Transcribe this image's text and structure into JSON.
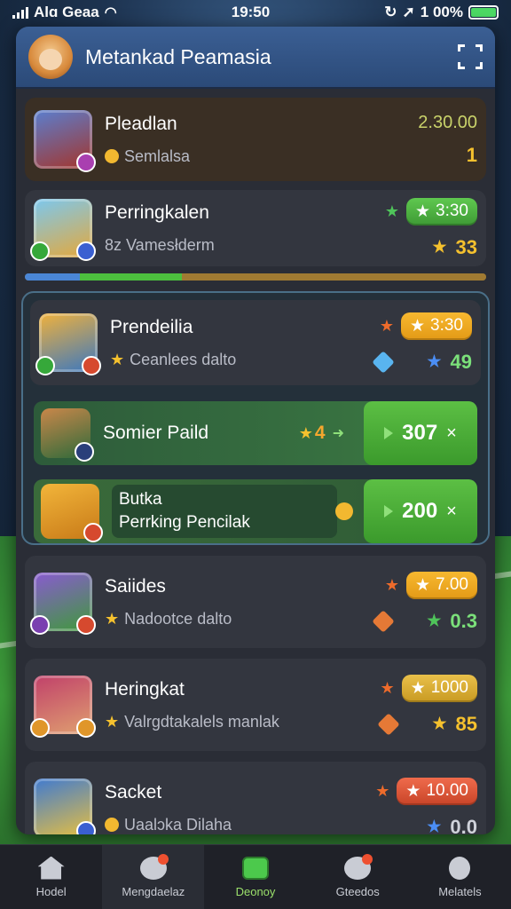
{
  "status": {
    "carrier": "Alɑ Geaa",
    "time": "19:50",
    "battery": "1 00%"
  },
  "panel": {
    "title": "Metankad Peamasia"
  },
  "rows": [
    {
      "name": "Pleadlan",
      "sub": "Semlalsa",
      "top": "2.30.00",
      "bottom": "1"
    },
    {
      "name": "Perringkalen",
      "sub": "8z Vamesłderm",
      "top": "3:30",
      "bottom": "33"
    },
    {
      "name": "Prendeilia",
      "sub": "Ceanlees dalto",
      "top": "3:30",
      "bottom": "49"
    },
    {
      "name": "Saiides",
      "sub": "Nadootce dalto",
      "top": "7.00",
      "bottom": "0.3"
    },
    {
      "name": "Heringkat",
      "sub": "Valrgdtakalels manlak",
      "top": "1000",
      "bottom": "85"
    },
    {
      "name": "Sacket",
      "sub": "Uaalɔka Dilaha",
      "top": "10.00",
      "bottom": "0.0"
    }
  ],
  "green_rows": [
    {
      "name": "Somier Paild",
      "badge": "4",
      "value": "307",
      "close": "×"
    },
    {
      "name_line1": "Butka",
      "name_line2": "Perrking Pencilak",
      "value": "200",
      "close": "×"
    }
  ],
  "progress": {
    "blue": 0.12,
    "green": 0.22,
    "gold": 0.66
  },
  "nav": [
    {
      "label": "Hodel"
    },
    {
      "label": "Mengdaelaz"
    },
    {
      "label": "Deonoy"
    },
    {
      "label": "Gteedos"
    },
    {
      "label": "Melatels"
    }
  ]
}
